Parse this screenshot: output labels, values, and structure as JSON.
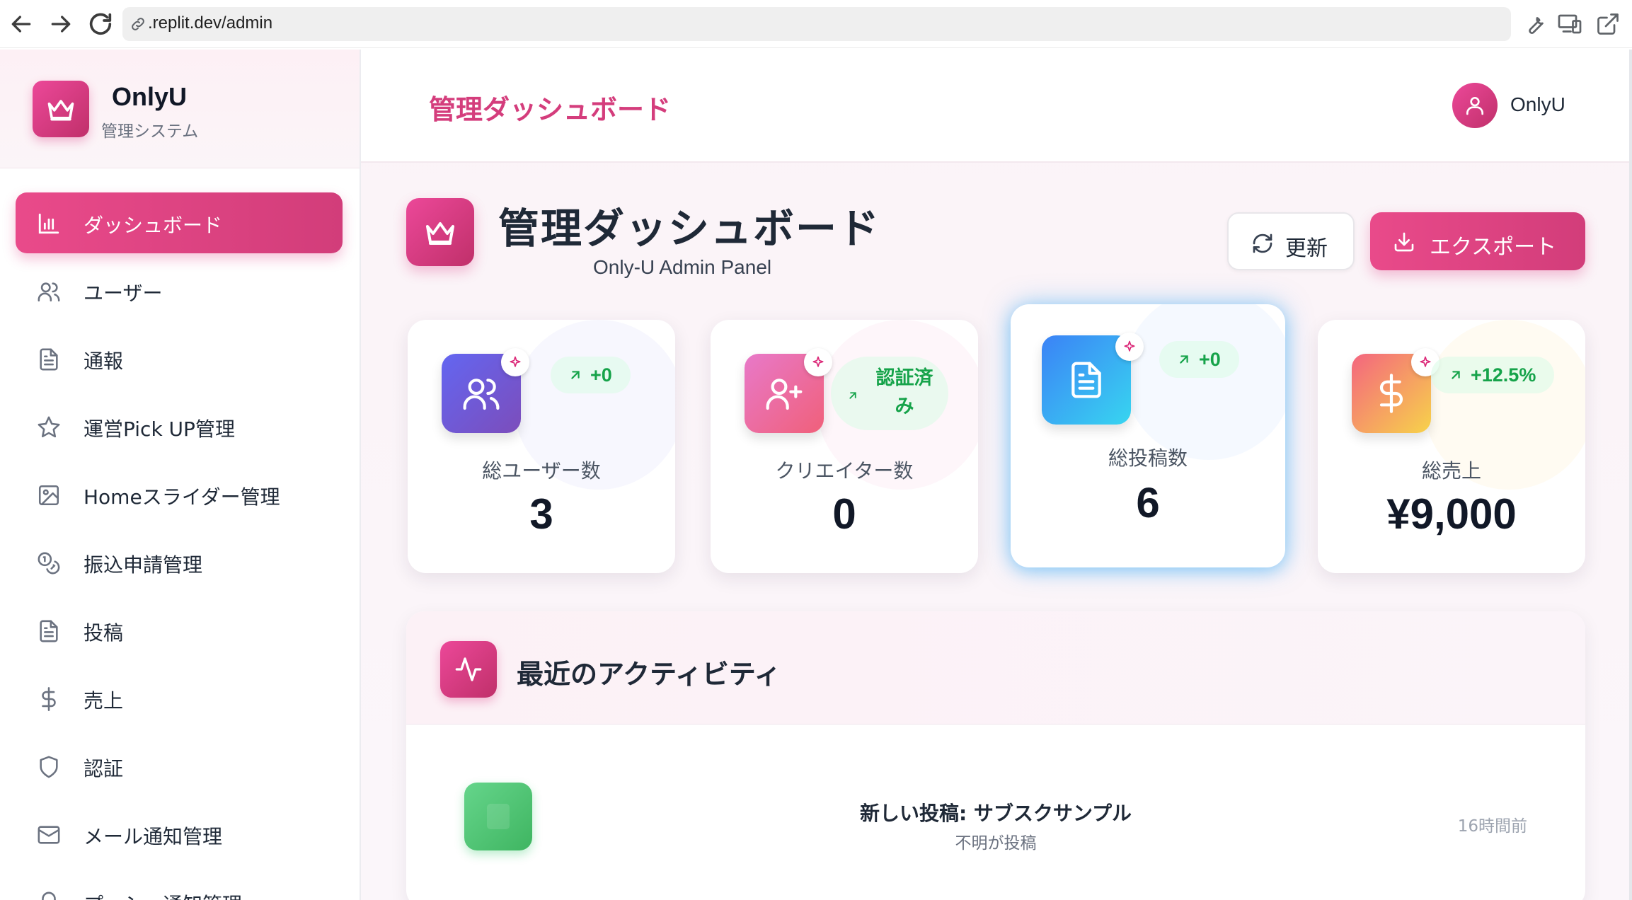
{
  "browser": {
    "url": ".replit.dev/admin"
  },
  "sidebar": {
    "brand": {
      "name": "OnlyU",
      "subtitle": "管理システム"
    },
    "items": [
      {
        "label": "ダッシュボード",
        "icon": "bar-chart-icon",
        "active": true
      },
      {
        "label": "ユーザー",
        "icon": "users-icon"
      },
      {
        "label": "通報",
        "icon": "file-text-icon"
      },
      {
        "label": "運営Pick UP管理",
        "icon": "star-icon"
      },
      {
        "label": "Homeスライダー管理",
        "icon": "image-icon"
      },
      {
        "label": "振込申請管理",
        "icon": "coins-icon"
      },
      {
        "label": "投稿",
        "icon": "file-text-icon"
      },
      {
        "label": "売上",
        "icon": "dollar-icon"
      },
      {
        "label": "認証",
        "icon": "shield-icon"
      },
      {
        "label": "メール通知管理",
        "icon": "mail-icon"
      },
      {
        "label": "プッシュ通知管理",
        "icon": "bell-icon"
      }
    ]
  },
  "header": {
    "title": "管理ダッシュボード",
    "user_name": "OnlyU"
  },
  "page": {
    "title": "管理ダッシュボード",
    "subtitle": "Only-U Admin Panel",
    "refresh_label": "更新",
    "export_label": "エクスポート"
  },
  "stats": [
    {
      "label": "総ユーザー数",
      "value": "3",
      "trend": "+0",
      "icon": "users-icon",
      "color_from": "#6366f1",
      "color_to": "#7c4dbb"
    },
    {
      "label": "クリエイター数",
      "value": "0",
      "trend": "認証済み",
      "icon": "user-plus-icon",
      "color_from": "#e879c9",
      "color_to": "#f0607a"
    },
    {
      "label": "総投稿数",
      "value": "6",
      "trend": "+0",
      "icon": "file-text-icon",
      "color_from": "#3b82f6",
      "color_to": "#38d5f0"
    },
    {
      "label": "総売上",
      "value": "¥9,000",
      "trend": "+12.5%",
      "icon": "dollar-icon",
      "color_from": "#f4657f",
      "color_to": "#f7d34a"
    }
  ],
  "activity": {
    "title": "最近のアクティビティ",
    "items": [
      {
        "title": "新しい投稿: サブスクサンプル",
        "subtitle": "不明が投稿",
        "time": "16時間前"
      }
    ]
  },
  "colors": {
    "accent": "#db2777",
    "trend_green": "#16a34a"
  }
}
